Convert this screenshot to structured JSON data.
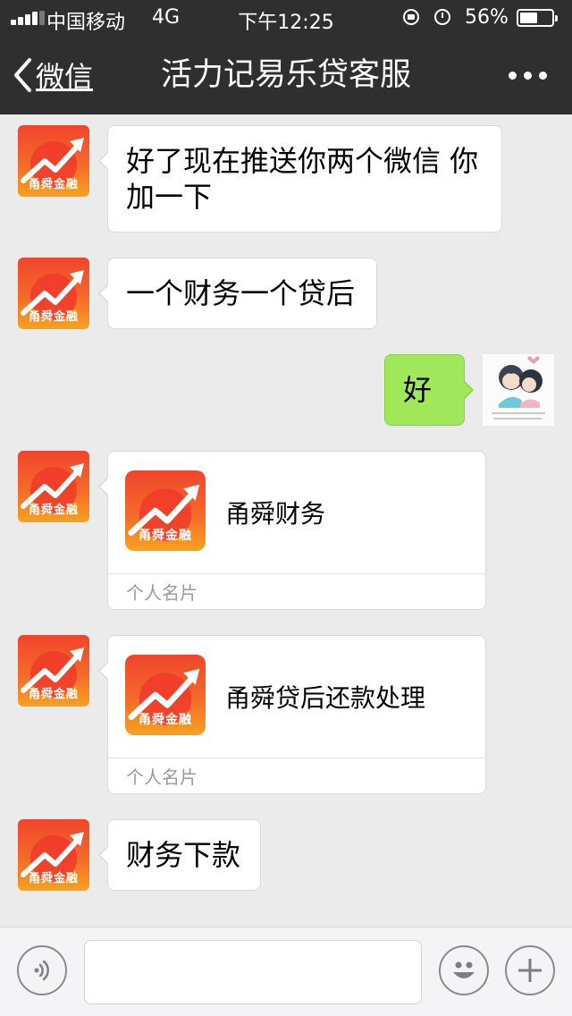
{
  "status_bar": {
    "carrier": "中国移动",
    "network": "4G",
    "time": "下午12:25",
    "battery_percent": "56%",
    "battery_level": 0.56
  },
  "nav": {
    "back_label": "微信",
    "title": "活力记易乐贷客服"
  },
  "contact_avatar": {
    "brand_text": "甬舜金融"
  },
  "messages": [
    {
      "type": "text",
      "from": "contact",
      "text": "好了现在推送你两个微信 你加一下"
    },
    {
      "type": "text",
      "from": "contact",
      "text": "一个财务一个贷后"
    },
    {
      "type": "text",
      "from": "self",
      "text": "好"
    },
    {
      "type": "card",
      "from": "contact",
      "name": "甬舜财务",
      "footer": "个人名片"
    },
    {
      "type": "card",
      "from": "contact",
      "name": "甬舜贷后还款处理",
      "footer": "个人名片"
    },
    {
      "type": "text",
      "from": "contact",
      "text": "财务下款"
    }
  ],
  "colors": {
    "bar_dark": "#2f2f2f",
    "chat_background": "#ebebeb",
    "self_bubble": "#a0e75a",
    "logo_red": "#f0452c",
    "logo_orange": "#f7a21f"
  }
}
